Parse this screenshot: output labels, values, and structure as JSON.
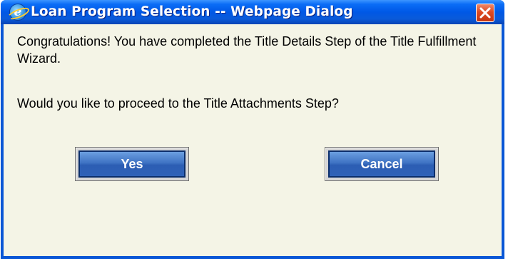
{
  "window": {
    "title": "Loan Program Selection -- Webpage Dialog",
    "title_icon": "internet-explorer-icon",
    "close_icon": "close-x-icon"
  },
  "message": {
    "line1": "Congratulations! You have completed the Title Details Step of the Title Fulfillment Wizard.",
    "line2": "Would you like to proceed to the Title Attachments Step?"
  },
  "buttons": {
    "yes_label": "Yes",
    "cancel_label": "Cancel"
  },
  "colors": {
    "titlebar": "#0058e6",
    "client_background": "#f4f4e6",
    "button": "#3f73c4",
    "close_button": "#de4a22"
  }
}
